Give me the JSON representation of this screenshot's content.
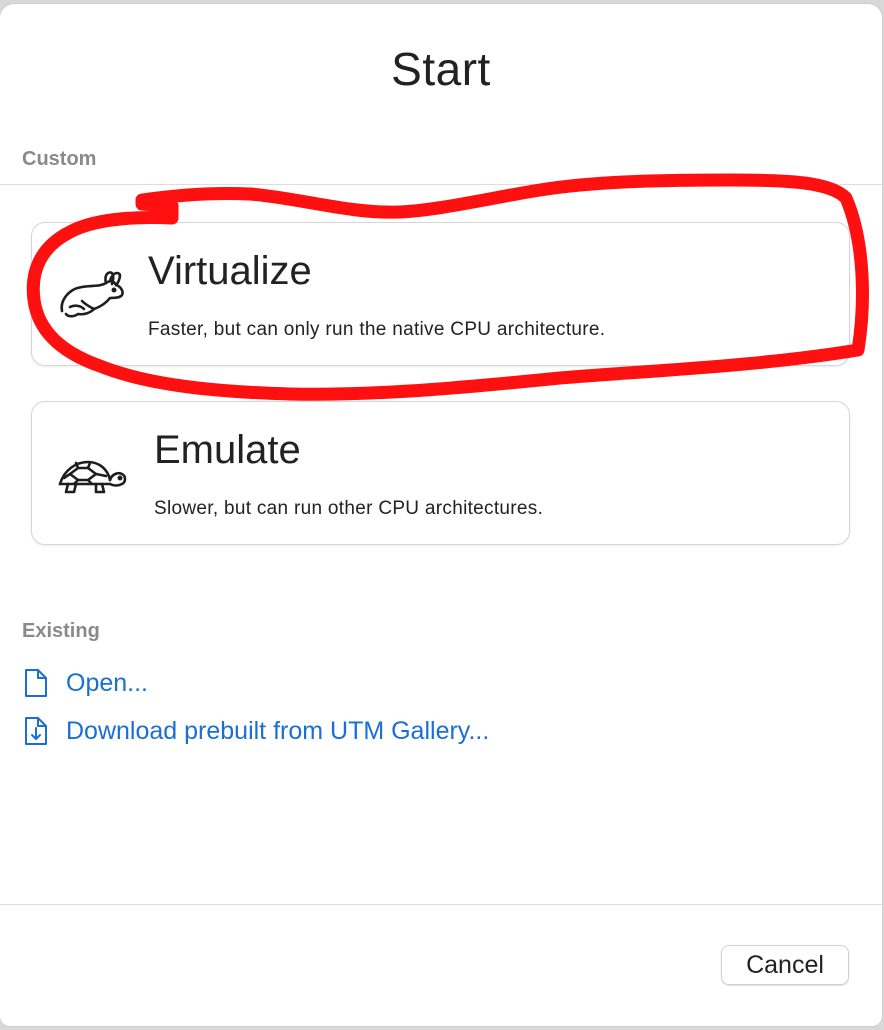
{
  "dialog": {
    "title": "Start"
  },
  "custom_section": {
    "label": "Custom",
    "options": [
      {
        "title": "Virtualize",
        "description": "Faster, but can only run the native CPU architecture.",
        "icon": "rabbit-icon"
      },
      {
        "title": "Emulate",
        "description": "Slower, but can run other CPU architectures.",
        "icon": "turtle-icon"
      }
    ]
  },
  "existing_section": {
    "label": "Existing",
    "links": [
      {
        "label": "Open...",
        "icon": "document-icon"
      },
      {
        "label": "Download prebuilt from UTM Gallery...",
        "icon": "document-download-icon"
      }
    ]
  },
  "footer": {
    "cancel_label": "Cancel"
  },
  "colors": {
    "link": "#1a6fd6",
    "annotation": "#ff0000",
    "section_label": "#8a8a8a"
  }
}
